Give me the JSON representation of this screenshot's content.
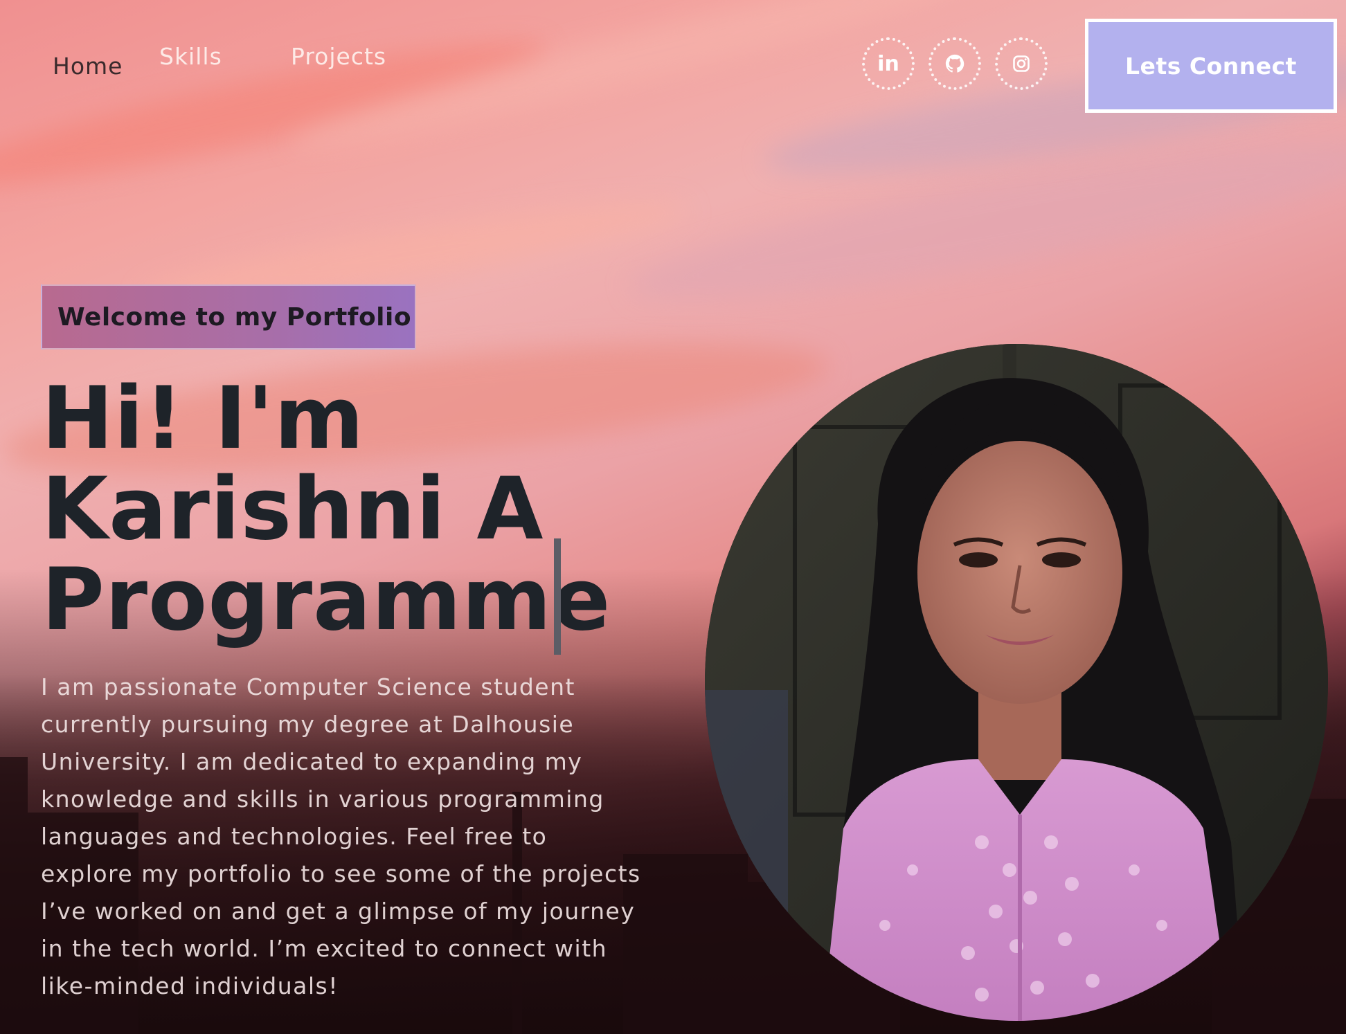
{
  "nav": {
    "links": [
      {
        "label": "Home"
      },
      {
        "label": "Skills"
      },
      {
        "label": "Projects"
      }
    ],
    "social_icons": [
      "linkedin-icon",
      "github-icon",
      "instagram-icon"
    ],
    "linkedin_glyph": "in",
    "connect_label": "Lets Connect"
  },
  "hero": {
    "tagline": "Welcome to my Portfolio",
    "headline_lines": [
      "Hi! I'm",
      "Karishni A",
      "Programme"
    ],
    "bio_lines": [
      "I am passionate Computer Science student",
      "currently pursuing my degree at Dalhousie",
      "University. I am dedicated to expanding my",
      "knowledge and skills in various programming",
      "languages and technologies. Feel free to",
      "explore my portfolio to see some of the projects",
      "I’ve worked on and get a glimpse of my journey",
      "in the tech world. I’m excited to connect with",
      "like-minded individuals!"
    ]
  },
  "colors": {
    "connect_button_bg": "#b3b1ee",
    "headline_text": "#1e2329",
    "tag_gradient_start": "#b86a8f",
    "tag_gradient_end": "#9a72c0"
  }
}
